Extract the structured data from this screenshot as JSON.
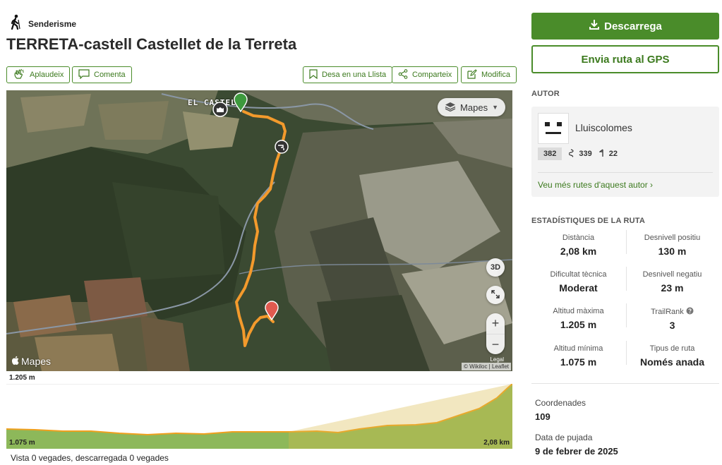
{
  "header": {
    "activity_icon": "hiker-icon",
    "activity": "Senderisme",
    "title": "TERRETA-castell Castellet de la Terreta"
  },
  "actions": {
    "applaud": "Aplaudeix",
    "comment": "Comenta",
    "save_list": "Desa en una Llista",
    "share": "Comparteix",
    "edit": "Modifica"
  },
  "map": {
    "layer_button": "Mapes",
    "btn_3d": "3D",
    "zoom_in": "+",
    "zoom_out": "−",
    "brand": "Mapes",
    "legal": "Legal",
    "attribution": "© Wikiloc | Leaflet",
    "place_label": "EL CASTELLE",
    "route_color": "#f39a2c",
    "start_marker_color": "#3d9a3d",
    "end_marker_color": "#e05a4f"
  },
  "elevation": {
    "max_label": "1.205 m",
    "min_label": "1.075 m",
    "distance_label": "2,08 km",
    "fill_color": "#8db85a",
    "line_color": "#f0a01e"
  },
  "views_text": "Vista 0 vegades, descarregada 0 vegades",
  "sidebar": {
    "download": "Descarrega",
    "send_gps": "Envia ruta al GPS",
    "author_heading": "AUTOR",
    "author": {
      "name": "Lluiscolomes",
      "rank": "382",
      "routes": "339",
      "followers": "22",
      "more_link": "Veu més rutes d'aquest autor ›"
    },
    "stats_heading": "ESTADÍSTIQUES DE LA RUTA",
    "stats": [
      {
        "label": "Distància",
        "value": "2,08 km"
      },
      {
        "label": "Desnivell positiu",
        "value": "130 m"
      },
      {
        "label": "Dificultat tècnica",
        "value": "Moderat"
      },
      {
        "label": "Desnivell negatiu",
        "value": "23 m"
      },
      {
        "label": "Altitud màxima",
        "value": "1.205 m"
      },
      {
        "label": "TrailRank",
        "value": "3"
      },
      {
        "label": "Altitud mínima",
        "value": "1.075 m"
      },
      {
        "label": "Tipus de ruta",
        "value": "Només anada"
      }
    ],
    "coords_label": "Coordenades",
    "coords_value": "109",
    "upload_label": "Data de pujada",
    "upload_value": "9 de febrer de 2025"
  },
  "colors": {
    "accent": "#4a8c2a"
  }
}
